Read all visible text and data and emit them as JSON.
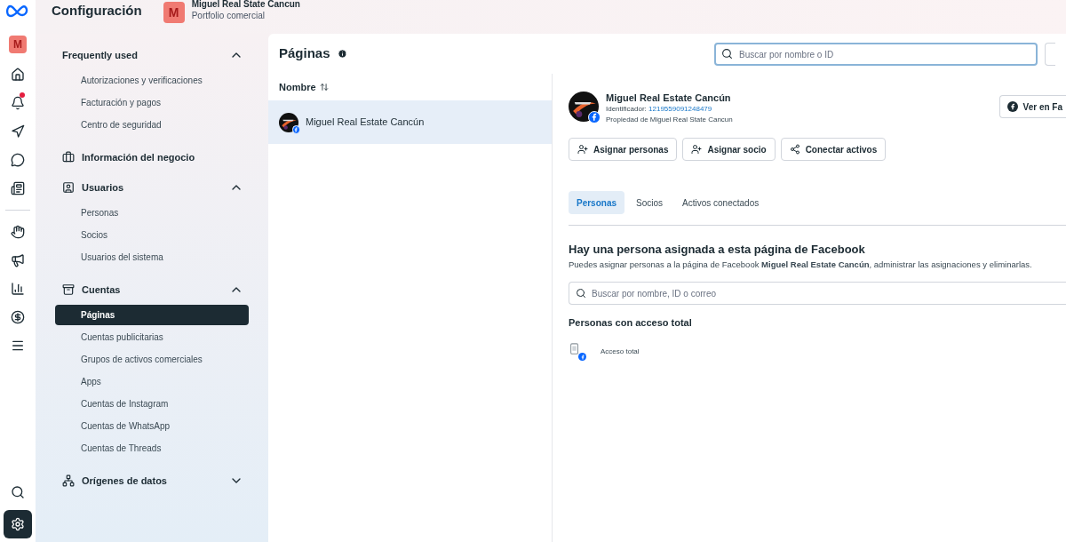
{
  "header": {
    "title": "Configuración",
    "account": {
      "initial": "M",
      "name": "Miguel Real State Cancun",
      "subtitle": "Portfolio comercial"
    }
  },
  "rail": {
    "avatar": "M",
    "items": [
      {
        "kind": "home"
      },
      {
        "kind": "bell",
        "notification": true
      },
      {
        "kind": "compass"
      },
      {
        "kind": "chat"
      },
      {
        "kind": "pages"
      },
      {
        "kind": "divider"
      },
      {
        "kind": "hand"
      },
      {
        "kind": "megaphone"
      },
      {
        "kind": "chart"
      },
      {
        "kind": "dollar"
      },
      {
        "kind": "menu"
      }
    ],
    "bottom_items": [
      {
        "kind": "search",
        "selected": false
      },
      {
        "kind": "settings",
        "selected": true
      }
    ]
  },
  "sidebar": {
    "groups": [
      {
        "label": "Frequently used",
        "expanded": true,
        "children": [
          {
            "label": "Autorizaciones y verificaciones",
            "selected": false
          },
          {
            "label": "Facturación y pagos",
            "selected": false
          },
          {
            "label": "Centro de seguridad",
            "selected": false
          }
        ]
      },
      {
        "label": "Información del negocio"
      },
      {
        "label": "Usuarios",
        "expanded": true,
        "children": [
          {
            "label": "Personas",
            "selected": false
          },
          {
            "label": "Socios",
            "selected": false
          },
          {
            "label": "Usuarios del sistema",
            "selected": false
          }
        ]
      },
      {
        "label": "Cuentas",
        "expanded": true,
        "children": [
          {
            "label": "Páginas",
            "selected": true
          },
          {
            "label": "Cuentas publicitarias",
            "selected": false
          },
          {
            "label": "Grupos de activos comerciales",
            "selected": false
          },
          {
            "label": "Apps",
            "selected": false
          },
          {
            "label": "Cuentas de Instagram",
            "selected": false
          },
          {
            "label": "Cuentas de WhatsApp",
            "selected": false
          },
          {
            "label": "Cuentas de Threads",
            "selected": false
          }
        ]
      },
      {
        "label": "Orígenes de datos",
        "expanded": false
      }
    ]
  },
  "pages_panel": {
    "title": "Páginas",
    "search": {
      "placeholder": "Buscar por nombre o ID"
    },
    "column": "Nombre",
    "rows": [
      {
        "name": "Miguel Real Estate Cancún",
        "selected": true
      }
    ]
  },
  "detail": {
    "name": "Miguel Real Estate Cancún",
    "id_label": "Identificador:",
    "id": "1219559091248479",
    "owner": "Propiedad de Miguel Real State Cancun",
    "view_button": "Ver en Fa",
    "actions": [
      {
        "kind": "person",
        "label": "Asignar personas"
      },
      {
        "kind": "person",
        "label": "Asignar socio"
      },
      {
        "kind": "connect",
        "label": "Conectar activos"
      }
    ],
    "tabs": [
      {
        "label": "Personas",
        "selected": true
      },
      {
        "label": "Socios",
        "selected": false
      },
      {
        "label": "Activos conectados",
        "selected": false
      }
    ],
    "heading": "Hay una persona asignada a esta página de Facebook",
    "description": "Puedes asignar personas a la página de Facebook **Miguel Real Estate Cancún**, administrar las asignaciones y eliminarlas.",
    "search": {
      "placeholder": "Buscar por nombre, ID o correo"
    },
    "section": "Personas con acceso total",
    "access": "Acceso total"
  }
}
